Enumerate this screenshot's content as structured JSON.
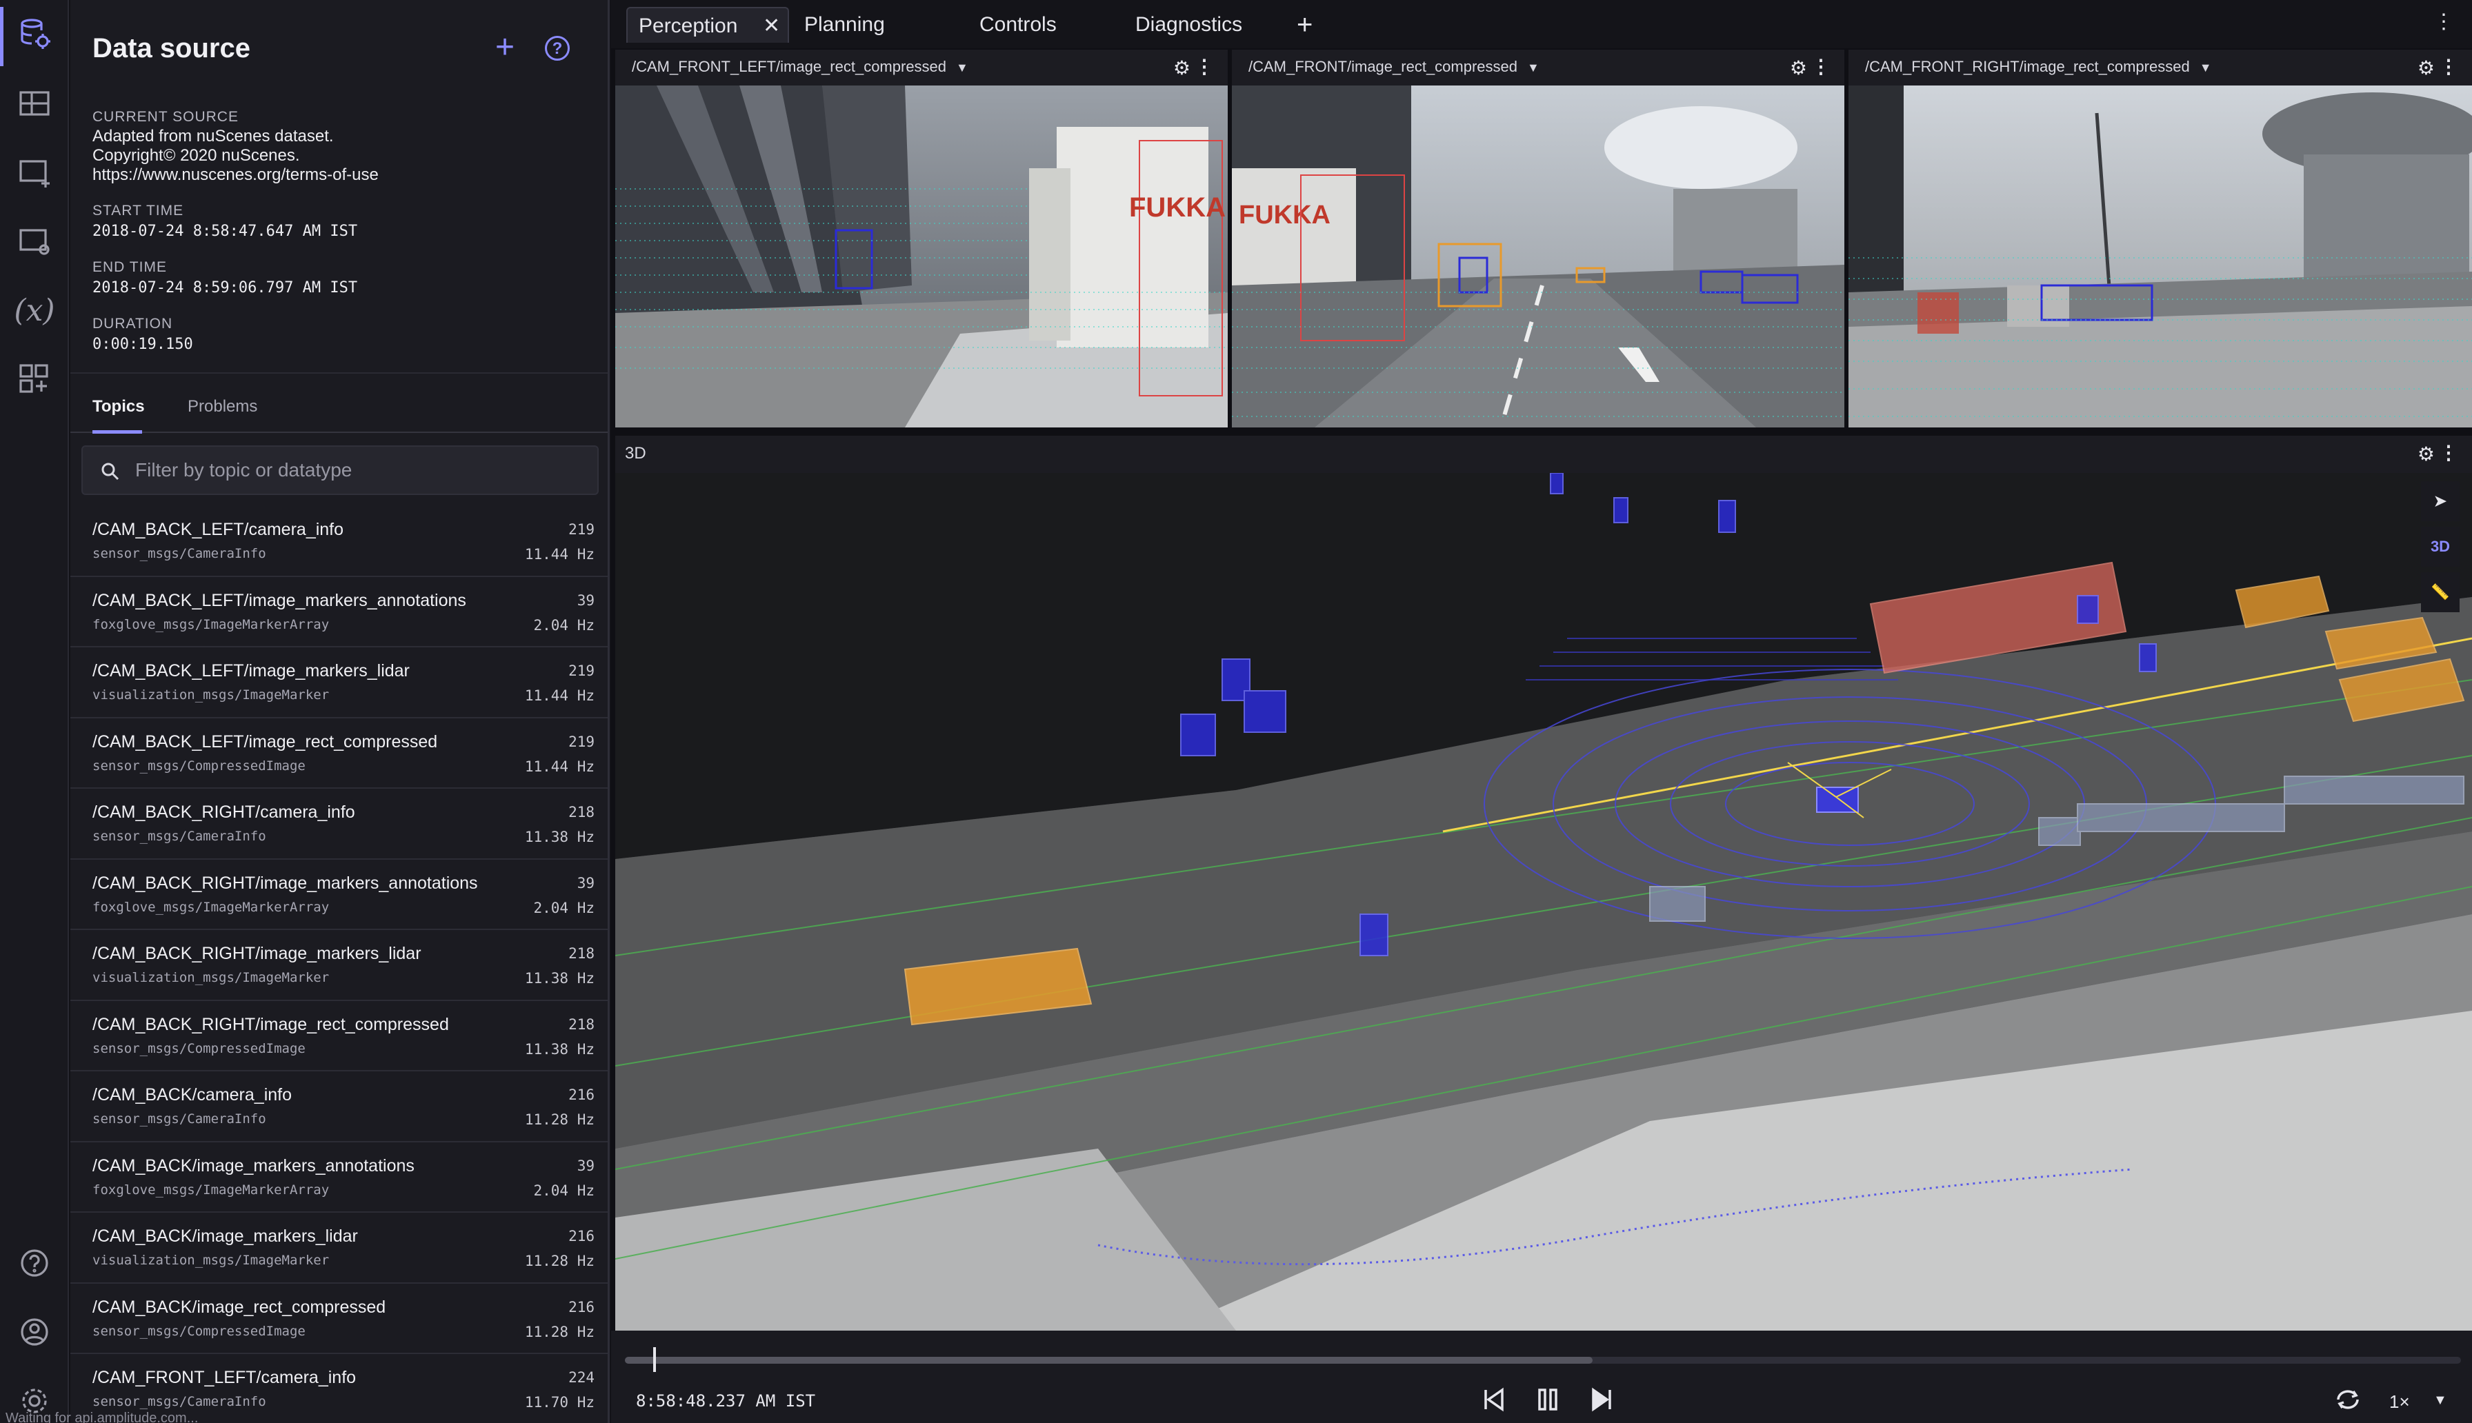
{
  "sidebar": {
    "title": "Data source",
    "current_source_label": "CURRENT SOURCE",
    "current_source_lines": [
      "Adapted from nuScenes dataset.",
      "Copyright© 2020 nuScenes.",
      "https://www.nuscenes.org/terms-of-use"
    ],
    "start_time_label": "START TIME",
    "start_time": "2018-07-24 8:58:47.647 AM IST",
    "end_time_label": "END TIME",
    "end_time": "2018-07-24 8:59:06.797 AM IST",
    "duration_label": "DURATION",
    "duration": "0:00:19.150",
    "tabs": [
      {
        "label": "Topics"
      },
      {
        "label": "Problems"
      }
    ],
    "filter_placeholder": "Filter by topic or datatype",
    "topics": [
      {
        "name": "/CAM_BACK_LEFT/camera_info",
        "type": "sensor_msgs/CameraInfo",
        "count": "219",
        "hz": "11.44 Hz"
      },
      {
        "name": "/CAM_BACK_LEFT/image_markers_annotations",
        "type": "foxglove_msgs/ImageMarkerArray",
        "count": "39",
        "hz": "2.04 Hz"
      },
      {
        "name": "/CAM_BACK_LEFT/image_markers_lidar",
        "type": "visualization_msgs/ImageMarker",
        "count": "219",
        "hz": "11.44 Hz"
      },
      {
        "name": "/CAM_BACK_LEFT/image_rect_compressed",
        "type": "sensor_msgs/CompressedImage",
        "count": "219",
        "hz": "11.44 Hz"
      },
      {
        "name": "/CAM_BACK_RIGHT/camera_info",
        "type": "sensor_msgs/CameraInfo",
        "count": "218",
        "hz": "11.38 Hz"
      },
      {
        "name": "/CAM_BACK_RIGHT/image_markers_annotations",
        "type": "foxglove_msgs/ImageMarkerArray",
        "count": "39",
        "hz": "2.04 Hz"
      },
      {
        "name": "/CAM_BACK_RIGHT/image_markers_lidar",
        "type": "visualization_msgs/ImageMarker",
        "count": "218",
        "hz": "11.38 Hz"
      },
      {
        "name": "/CAM_BACK_RIGHT/image_rect_compressed",
        "type": "sensor_msgs/CompressedImage",
        "count": "218",
        "hz": "11.38 Hz"
      },
      {
        "name": "/CAM_BACK/camera_info",
        "type": "sensor_msgs/CameraInfo",
        "count": "216",
        "hz": "11.28 Hz"
      },
      {
        "name": "/CAM_BACK/image_markers_annotations",
        "type": "foxglove_msgs/ImageMarkerArray",
        "count": "39",
        "hz": "2.04 Hz"
      },
      {
        "name": "/CAM_BACK/image_markers_lidar",
        "type": "visualization_msgs/ImageMarker",
        "count": "216",
        "hz": "11.28 Hz"
      },
      {
        "name": "/CAM_BACK/image_rect_compressed",
        "type": "sensor_msgs/CompressedImage",
        "count": "216",
        "hz": "11.28 Hz"
      },
      {
        "name": "/CAM_FRONT_LEFT/camera_info",
        "type": "sensor_msgs/CameraInfo",
        "count": "224",
        "hz": "11.70 Hz"
      }
    ],
    "status_text": "Waiting for api.amplitude.com..."
  },
  "layout_tabs": [
    {
      "label": "Perception",
      "active": true
    },
    {
      "label": "Planning"
    },
    {
      "label": "Controls"
    },
    {
      "label": "Diagnostics"
    }
  ],
  "camera_panels": [
    {
      "topic": "/CAM_FRONT_LEFT/image_rect_compressed",
      "image_text": "FUKKA"
    },
    {
      "topic": "/CAM_FRONT/image_rect_compressed",
      "image_text": "FUKKA"
    },
    {
      "topic": "/CAM_FRONT_RIGHT/image_rect_compressed"
    }
  ],
  "panel_3d": {
    "title": "3D",
    "view_mode": "3D"
  },
  "playback": {
    "time": "8:58:48.237 AM IST",
    "speed": "1×",
    "progress_fraction": 0.0154,
    "loaded_fraction": 0.527
  },
  "colors": {
    "accent": "#8b8bff",
    "box_orange": "#e89a2c",
    "box_red": "#e0645a",
    "box_blue": "#2b2bd6"
  }
}
